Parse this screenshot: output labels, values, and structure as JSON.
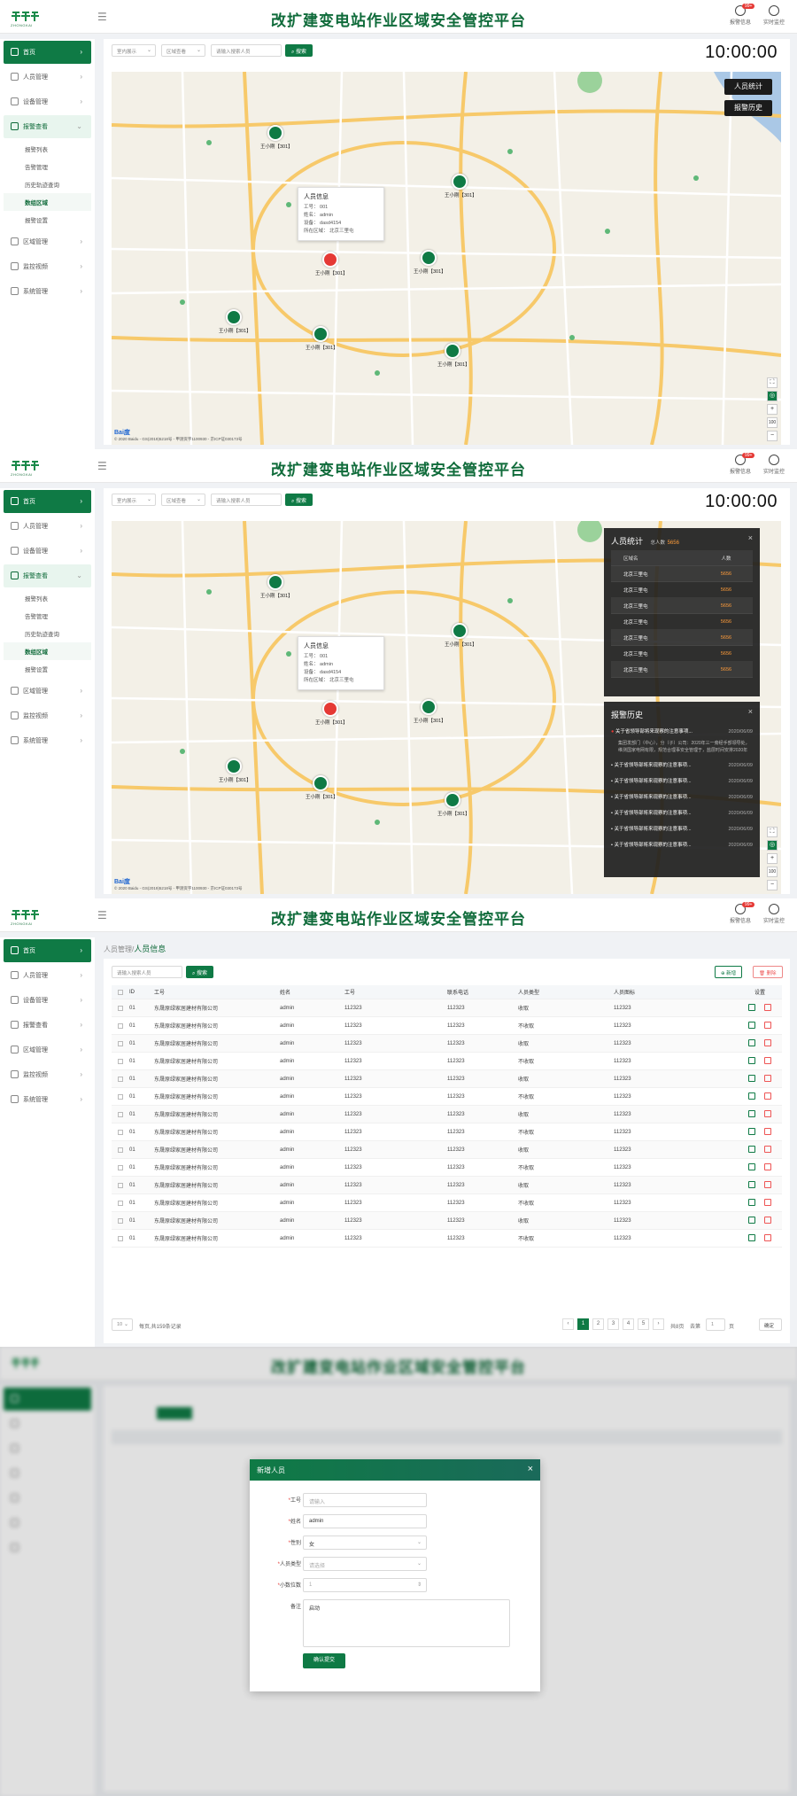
{
  "app": {
    "title": "改扩建变电站作业区域安全管控平台",
    "logo_text": "ZHONGKAI",
    "alarm_label": "报警信息",
    "alarm_count": "99+",
    "monitor_label": "实时监控"
  },
  "nav": {
    "home": "首页",
    "people": "人员管理",
    "device": "设备管理",
    "alarm": "报警查看",
    "area": "区域管理",
    "video": "监控视频",
    "system": "系统管理",
    "alarm_sub": [
      "报警列表",
      "告警管理",
      "历史轨迹查询",
      "数组区域",
      "报警设置"
    ]
  },
  "map": {
    "filter1": "室内展示",
    "filter2": "区域查看",
    "search_placeholder": "请输入搜索人员",
    "search_btn": "搜索",
    "clock": "10:00:00",
    "btn_stats": "人员统计",
    "btn_history": "报警历史",
    "copyright": "© 2020 Baidu - GS(2019)5218号 - 甲测资字1100930 - 京ICP证030173号",
    "popup": {
      "title": "人员信息",
      "rows": [
        "工号： 001",
        "姓名： admin",
        "设备： dasd4154",
        "所在区域： 北京三里屯"
      ]
    },
    "pins": [
      "王小刚【301】",
      "王小刚【301】",
      "王小刚【301】",
      "王小刚【301】",
      "王小刚【301】",
      "王小刚【301】",
      "王小刚【301】"
    ],
    "zoom": "100"
  },
  "stats_panel": {
    "title": "人员统计",
    "total_label": "总人数",
    "total": "5656",
    "col_area": "区域名",
    "col_count": "人数",
    "rows": [
      [
        "北京三里屯",
        "5656"
      ],
      [
        "北京三里屯",
        "5656"
      ],
      [
        "北京三里屯",
        "5656"
      ],
      [
        "北京三里屯",
        "5656"
      ],
      [
        "北京三里屯",
        "5656"
      ],
      [
        "北京三里屯",
        "5656"
      ],
      [
        "北京三里屯",
        "5656"
      ]
    ]
  },
  "history_panel": {
    "title": "报警历史",
    "first": {
      "title": "关于省领导部将来现察的注意事项...",
      "date": "2020/06/09",
      "detail": "集团发部门（中心），分（子）公司：2020年三一旁经手部领导处，维测国家电网有限，规范合理事安全管理于，盐层时间安排2020年"
    },
    "items": [
      [
        "关于省领导部将来现察的注意事项...",
        "2020/06/09"
      ],
      [
        "关于省领导部将来现察的注意事项...",
        "2020/06/09"
      ],
      [
        "关于省领导部将来现察的注意事项...",
        "2020/06/09"
      ],
      [
        "关于省领导部将来现察的注意事项...",
        "2020/06/09"
      ],
      [
        "关于省领导部将来现察的注意事项...",
        "2020/06/09"
      ],
      [
        "关于省领导部将来现察的注意事项...",
        "2020/06/09"
      ]
    ]
  },
  "people": {
    "crumb_parent": "人员管理/",
    "crumb_current": "人员信息",
    "search_placeholder": "请输入搜索人员",
    "search_btn": "搜索",
    "add_btn": "新增",
    "delete_btn": "删除",
    "columns": [
      "ID",
      "工号",
      "姓名",
      "工号",
      "联系电话",
      "人员类型",
      "人员图标",
      "设置"
    ],
    "rows": [
      [
        "01",
        "东晟原绿家居建材有限公司",
        "admin",
        "112323",
        "112323",
        "收取",
        "112323"
      ],
      [
        "01",
        "东晟原绿家居建材有限公司",
        "admin",
        "112323",
        "112323",
        "不收取",
        "112323"
      ],
      [
        "01",
        "东晟原绿家居建材有限公司",
        "admin",
        "112323",
        "112323",
        "收取",
        "112323"
      ],
      [
        "01",
        "东晟原绿家居建材有限公司",
        "admin",
        "112323",
        "112323",
        "不收取",
        "112323"
      ],
      [
        "01",
        "东晟原绿家居建材有限公司",
        "admin",
        "112323",
        "112323",
        "收取",
        "112323"
      ],
      [
        "01",
        "东晟原绿家居建材有限公司",
        "admin",
        "112323",
        "112323",
        "不收取",
        "112323"
      ],
      [
        "01",
        "东晟原绿家居建材有限公司",
        "admin",
        "112323",
        "112323",
        "收取",
        "112323"
      ],
      [
        "01",
        "东晟原绿家居建材有限公司",
        "admin",
        "112323",
        "112323",
        "不收取",
        "112323"
      ],
      [
        "01",
        "东晟原绿家居建材有限公司",
        "admin",
        "112323",
        "112323",
        "收取",
        "112323"
      ],
      [
        "01",
        "东晟原绿家居建材有限公司",
        "admin",
        "112323",
        "112323",
        "不收取",
        "112323"
      ],
      [
        "01",
        "东晟原绿家居建材有限公司",
        "admin",
        "112323",
        "112323",
        "收取",
        "112323"
      ],
      [
        "01",
        "东晟原绿家居建材有限公司",
        "admin",
        "112323",
        "112323",
        "不收取",
        "112323"
      ],
      [
        "01",
        "东晟原绿家居建材有限公司",
        "admin",
        "112323",
        "112323",
        "收取",
        "112323"
      ],
      [
        "01",
        "东晟原绿家居建材有限公司",
        "admin",
        "112323",
        "112323",
        "不收取",
        "112323"
      ]
    ],
    "page_size": "10",
    "page_info": "每页,共159条记录",
    "pages": [
      "1",
      "2",
      "3",
      "4",
      "5"
    ],
    "current_page": "1",
    "total_pages": "共8页",
    "goto": "去第",
    "goto_value": "1",
    "page_unit": "页",
    "confirm": "确定"
  },
  "modal": {
    "title": "新增人员",
    "close": "×",
    "fields": [
      {
        "label": "工号",
        "required": true,
        "value": "请输入",
        "placeholder": true
      },
      {
        "label": "姓名",
        "required": true,
        "value": "admin",
        "placeholder": false
      },
      {
        "label": "性别",
        "required": true,
        "value": "女",
        "placeholder": false
      },
      {
        "label": "人员类型",
        "required": true,
        "value": "请选择",
        "placeholder": true
      },
      {
        "label": "小数位数",
        "required": true,
        "value": "1",
        "placeholder": true
      },
      {
        "label": "备注",
        "required": false,
        "value": "启动",
        "placeholder": false
      }
    ],
    "submit": "确认提交"
  },
  "colors": {
    "primary": "#0f7a45",
    "danger": "#e53935",
    "panel": "#1e1e1e"
  }
}
